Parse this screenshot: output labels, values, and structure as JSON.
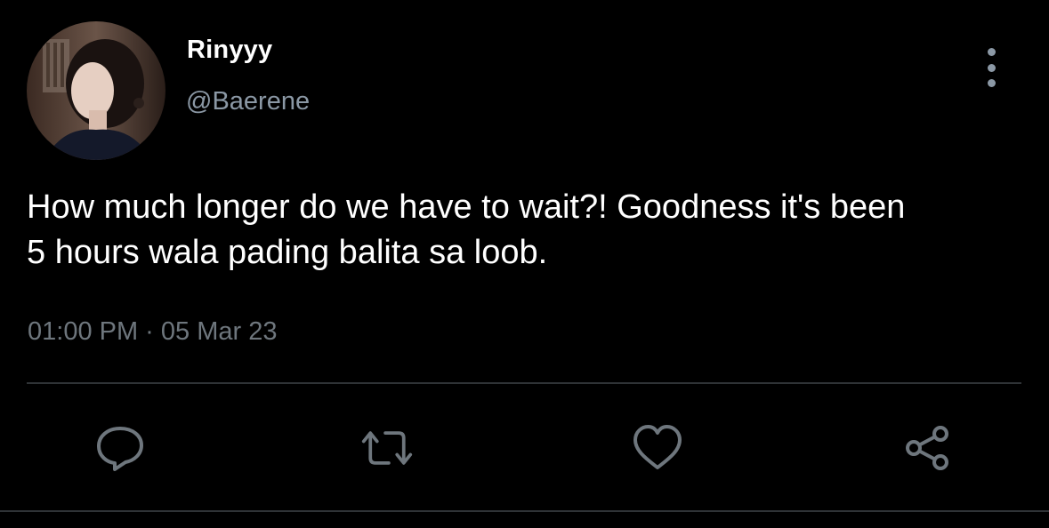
{
  "user": {
    "display_name": "Rinyyy",
    "handle": "@Baerene"
  },
  "tweet": {
    "text_line1": "How much longer do we have to wait?! Goodness it's been",
    "text_line2": "5 hours wala pading balita sa loob.",
    "timestamp": "01:00 PM · 05 Mar 23"
  },
  "actions": [
    {
      "icon": "reply-icon"
    },
    {
      "icon": "retweet-icon"
    },
    {
      "icon": "like-icon"
    },
    {
      "icon": "share-icon"
    }
  ],
  "colors": {
    "background": "#000000",
    "primary_text": "#ffffff",
    "secondary_text": "#8b98a5",
    "icon": "#6e767d",
    "divider": "#2f3336"
  }
}
